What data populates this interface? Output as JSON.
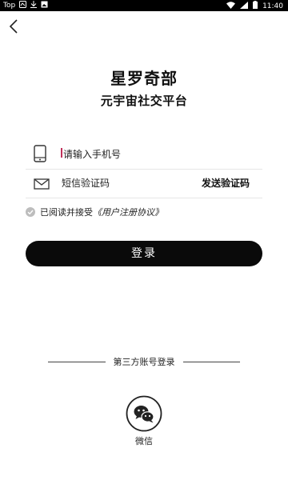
{
  "status_bar": {
    "left_label": "Top",
    "time": "11:40"
  },
  "header": {
    "app_name": "星罗奇部",
    "subtitle": "元宇宙社交平台"
  },
  "form": {
    "phone_placeholder": "请输入手机号",
    "code_placeholder": "短信验证码",
    "send_code_label": "发送验证码",
    "agreement_text": "已阅读并接受",
    "agreement_link": "《用户注册协议》",
    "agreement_checked": true,
    "login_label": "登录"
  },
  "third_party": {
    "title": "第三方账号登录",
    "wechat_label": "微信"
  },
  "colors": {
    "primary": "#0a0a0a",
    "cursor": "#c0305a"
  }
}
